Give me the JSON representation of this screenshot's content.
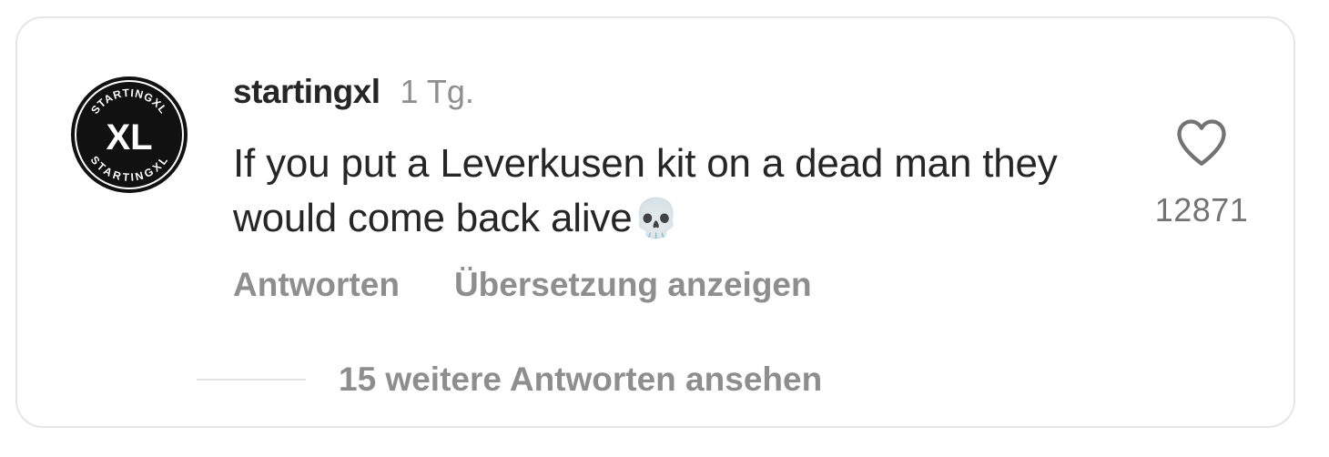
{
  "comment": {
    "avatar": {
      "icon": "startingxl-logo-icon",
      "logo_text_top": "STARTINGXL",
      "logo_text_center": "XL",
      "logo_text_bottom": "STARTINGXL"
    },
    "username": "startingxl",
    "timestamp": "1 Tg.",
    "text": "If you put a Leverkusen kit on a dead man they would come back alive",
    "emoji": "💀",
    "like": {
      "icon": "heart-icon",
      "count": "12871"
    },
    "actions": {
      "reply_label": "Antworten",
      "translate_label": "Übersetzung anzeigen"
    },
    "more_replies_label": "15 weitere Antworten ansehen"
  }
}
